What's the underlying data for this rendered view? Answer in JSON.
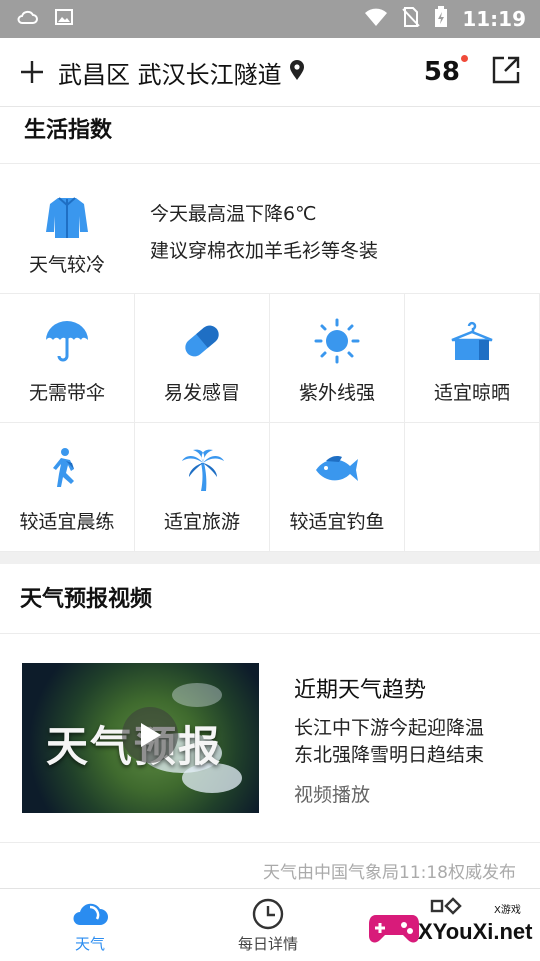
{
  "status_bar": {
    "time": "11:19"
  },
  "header": {
    "location": "武昌区 武汉长江隧道",
    "badge": "58"
  },
  "life_index": {
    "title": "生活指数",
    "feature": {
      "label": "天气较冷",
      "line1": "今天最高温下降6℃",
      "line2": "建议穿棉衣加羊毛衫等冬装"
    },
    "items": [
      {
        "label": "无需带伞",
        "icon": "umbrella-icon"
      },
      {
        "label": "易发感冒",
        "icon": "pill-icon"
      },
      {
        "label": "紫外线强",
        "icon": "sun-icon"
      },
      {
        "label": "适宜晾晒",
        "icon": "hanger-icon"
      },
      {
        "label": "较适宜晨练",
        "icon": "runner-icon"
      },
      {
        "label": "适宜旅游",
        "icon": "palm-tree-icon"
      },
      {
        "label": "较适宜钓鱼",
        "icon": "fish-icon"
      }
    ]
  },
  "video": {
    "title": "天气预报视频",
    "thumb_text": "天气预报",
    "headline": "近期天气趋势",
    "line1": "长江中下游今起迎降温",
    "line2": "东北强降雪明日趋结束",
    "play_label": "视频播放"
  },
  "source": "天气由中国气象局11:18权威发布",
  "tabs": [
    {
      "label": "天气",
      "active": true
    },
    {
      "label": "每日详情",
      "active": false
    }
  ],
  "watermark": {
    "text": "XYouXi.net",
    "small": "X游戏"
  },
  "colors": {
    "accent": "#2a8cf0",
    "status_bar": "#9e9e9e"
  }
}
